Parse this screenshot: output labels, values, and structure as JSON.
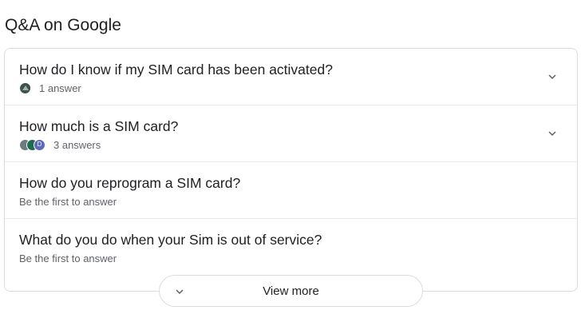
{
  "section": {
    "title": "Q&A on Google"
  },
  "questions": [
    {
      "text": "How do I know if my SIM card has been activated?",
      "meta": "1 answer",
      "icon": "chevron-down-icon"
    },
    {
      "text": "How much is a SIM card?",
      "meta": "3 answers",
      "icon": "chevron-down-icon",
      "avatar_letter": "D"
    },
    {
      "text": "How do you reprogram a SIM card?",
      "meta": "Be the first to answer"
    },
    {
      "text": "What do you do when your Sim is out of service?",
      "meta": "Be the first to answer"
    }
  ],
  "view_more": {
    "label": "View more",
    "icon": "chevron-down-icon"
  },
  "colors": {
    "avatar_green": "#1e6b52",
    "avatar_blue": "#5c6bc0",
    "avatar_gray": "#6d7a7f",
    "chevron": "#5f6368",
    "border": "#dadce0"
  }
}
